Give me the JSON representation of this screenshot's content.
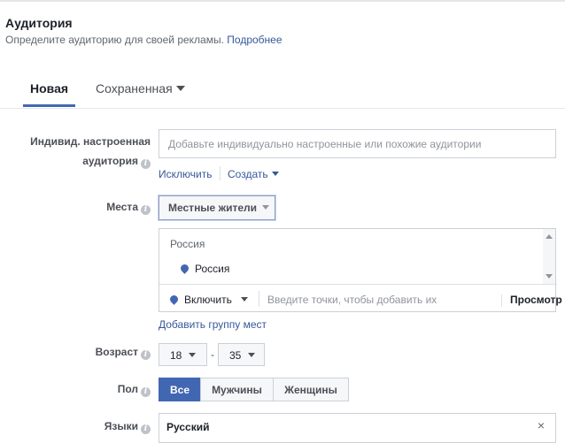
{
  "header": {
    "title": "Аудитория",
    "subtitle": "Определите аудиторию для своей рекламы.",
    "more_link": "Подробнее"
  },
  "tabs": [
    {
      "label": "Новая",
      "active": true
    },
    {
      "label": "Сохраненная",
      "active": false
    }
  ],
  "custom_audience": {
    "label_line1": "Индивид. настроенная",
    "label_line2": "аудитория",
    "placeholder": "Добавьте индивидуально настроенные или похожие аудитории",
    "exclude_link": "Исключить",
    "create_link": "Создать"
  },
  "places": {
    "label": "Места",
    "dropdown_value": "Местные жители",
    "country_header": "Россия",
    "selected_location": "Россия",
    "include_label": "Включить",
    "input_placeholder": "Введите точки, чтобы добавить их",
    "view_button": "Просмотр",
    "add_group_link": "Добавить группу мест"
  },
  "age": {
    "label": "Возраст",
    "min": "18",
    "separator": "-",
    "max": "35"
  },
  "gender": {
    "label": "Пол",
    "options": [
      "Все",
      "Мужчины",
      "Женщины"
    ],
    "selected": "Все"
  },
  "languages": {
    "label": "Языки",
    "value": "Русский",
    "remove_icon": "×"
  },
  "colors": {
    "accent": "#4267b2",
    "link": "#365899"
  }
}
